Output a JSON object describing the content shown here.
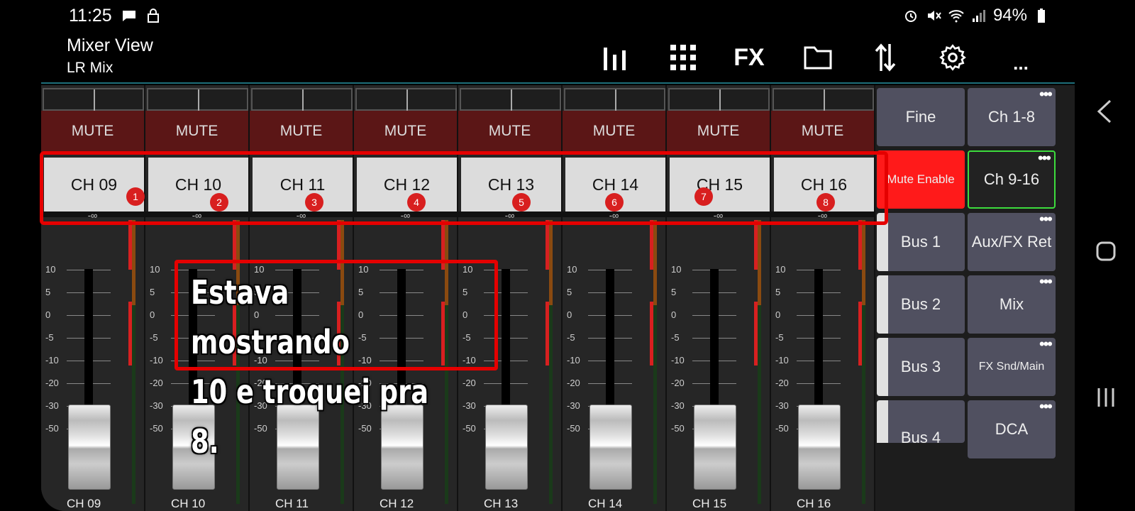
{
  "status": {
    "time": "11:25",
    "battery": "94%"
  },
  "titlebar": {
    "title": "Mixer View",
    "subtitle": "LR Mix",
    "fx_label": "FX",
    "more_label": "..."
  },
  "channels": [
    {
      "name": "CH 09",
      "mute": "MUTE",
      "inf": "-∞",
      "badge": "1"
    },
    {
      "name": "CH 10",
      "mute": "MUTE",
      "inf": "-∞",
      "badge": "2"
    },
    {
      "name": "CH 11",
      "mute": "MUTE",
      "inf": "-∞",
      "badge": "3"
    },
    {
      "name": "CH 12",
      "mute": "MUTE",
      "inf": "-∞",
      "badge": "4"
    },
    {
      "name": "CH 13",
      "mute": "MUTE",
      "inf": "-∞",
      "badge": "5"
    },
    {
      "name": "CH 14",
      "mute": "MUTE",
      "inf": "-∞",
      "badge": "6"
    },
    {
      "name": "CH 15",
      "mute": "MUTE",
      "inf": "-∞",
      "badge": "7"
    },
    {
      "name": "CH 16",
      "mute": "MUTE",
      "inf": "-∞",
      "badge": "8"
    }
  ],
  "scale": [
    "10",
    "5",
    "0",
    "-5",
    "-10",
    "-20",
    "-30",
    "-50"
  ],
  "panel": {
    "fine": "Fine",
    "mute_enable": "Mute Enable",
    "bus1": "Bus 1",
    "bus2": "Bus 2",
    "bus3": "Bus 3",
    "bus4": "Bus 4",
    "ch1_8": "Ch 1-8",
    "ch9_16": "Ch 9-16",
    "aux_fx_ret": "Aux/FX Ret",
    "mix": "Mix",
    "fx_snd_main": "FX Snd/Main",
    "dca": "DCA",
    "dots": "•••"
  },
  "annotation": {
    "line1": "Estava mostrando",
    "line2": "10 e troquei pra 8."
  },
  "colors": {
    "mute_enable": "#ff1a1a",
    "highlight": "#e50000",
    "selected_border": "#3ddc3d"
  }
}
